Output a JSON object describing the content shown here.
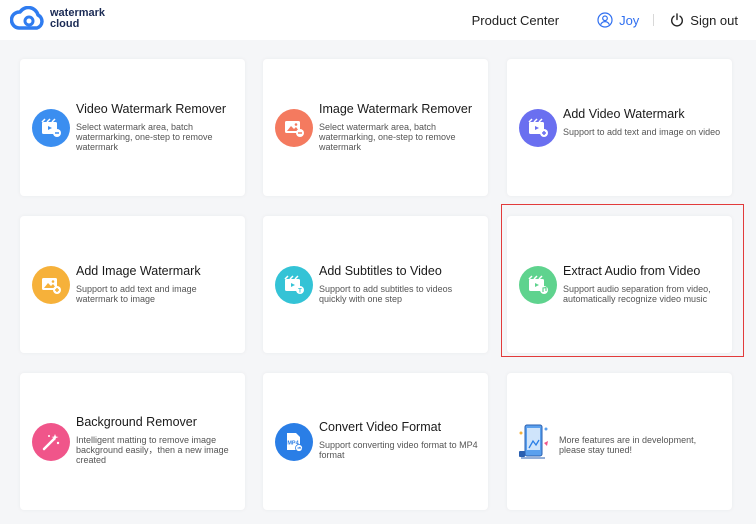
{
  "header": {
    "logo_line1": "watermark",
    "logo_line2": "cloud",
    "product_center": "Product Center",
    "user_name": "Joy",
    "sign_out": "Sign out"
  },
  "cards": [
    {
      "title": "Video Watermark Remover",
      "desc": "Select watermark area, batch watermarking, one-step to remove watermark",
      "color": "#3b8ef0"
    },
    {
      "title": "Image Watermark Remover",
      "desc": "Select watermark area, batch watermarking, one-step to remove watermark",
      "color": "#f47a5f"
    },
    {
      "title": "Add Video Watermark",
      "desc": "Support to add text and image on video",
      "color": "#6a6ff0"
    },
    {
      "title": "Add Image Watermark",
      "desc": "Support to add text and image watermark to image",
      "color": "#f6b13a"
    },
    {
      "title": "Add Subtitles to Video",
      "desc": "Support to add subtitles to videos quickly with one step",
      "color": "#34c3d6"
    },
    {
      "title": "Extract Audio from Video",
      "desc": "Support audio separation from video, automatically recognize video music",
      "color": "#5fd38e"
    },
    {
      "title": "Background Remover",
      "desc": "Intelligent matting to remove image background easily，then a new image created",
      "color": "#f0558a"
    },
    {
      "title": "Convert Video Format",
      "desc": "Support converting video format to MP4 format",
      "color": "#2a7ee6",
      "badge": "MP4"
    },
    {
      "title": "",
      "desc": "More features are in development, please stay tuned!"
    }
  ]
}
